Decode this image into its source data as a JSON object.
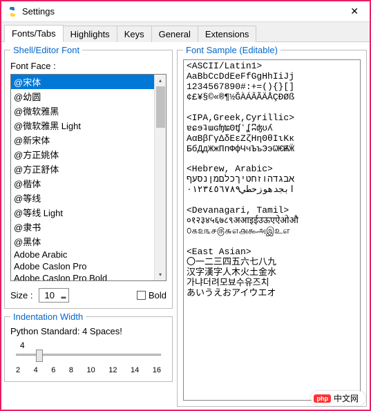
{
  "window": {
    "title": "Settings"
  },
  "tabs": [
    {
      "label": "Fonts/Tabs",
      "active": true
    },
    {
      "label": "Highlights"
    },
    {
      "label": "Keys"
    },
    {
      "label": "General"
    },
    {
      "label": "Extensions"
    }
  ],
  "shell_font": {
    "legend": "Shell/Editor Font",
    "face_label": "Font Face :",
    "items": [
      "@宋体",
      "@幼圆",
      "@微软雅黑",
      "@微软雅黑 Light",
      "@新宋体",
      "@方正姚体",
      "@方正舒体",
      "@楷体",
      "@等线",
      "@等线 Light",
      "@隶书",
      "@黑体",
      "Adobe Arabic",
      "Adobe Caslon Pro",
      "Adobe Caslon Pro Bold"
    ],
    "selected_index": 0,
    "size_label": "Size :",
    "size_value": "10",
    "bold_label": "Bold",
    "bold_checked": false
  },
  "indent": {
    "legend": "Indentation Width",
    "label": "Python Standard: 4 Spaces!",
    "value": "4",
    "ticks": [
      "2",
      "4",
      "6",
      "8",
      "10",
      "12",
      "14",
      "16"
    ]
  },
  "sample": {
    "legend": "Font Sample (Editable)",
    "lines": [
      "<ASCII/Latin1>",
      "AaBbCcDdEeFfGgHhIiJj",
      "1234567890#:+=(){}[]",
      "¢£¥§©«®¶½ĞÀÁÂÃÄÅÇÐØß",
      "",
      "<IPA,Greek,Cyrillic>",
      "ɐɕɘʇɯɢʩʨʘʧʻʆʭʤʊʎ",
      "ΑαΒβΓγΔδΕεΖζΗηΘθΙιΚκ",
      "БбДдЖжПпФфЧчЪъЭэѠѤѬӜ",
      "",
      "<Hebrew, Arabic>",
      "אבגדהוזחטיךכלםמןנסעף",
      "ابجدهوزحطي٠١٢٣٤٥٦٧٨٩",
      "",
      "<Devanagari, Tamil>",
      "०१२३४५६७८९अआइईउऊएऐओऔ",
      "௦௧௨௩௪௫௬௭௮௯அஇஉஎ",
      "",
      "<East Asian>",
      "〇一二三四五六七八九",
      "汉字漢字人木火土金水",
      "가냐더려모뵤수유즈치",
      "あいうえおアイウエオ"
    ]
  },
  "watermark": {
    "badge": "php",
    "text": "中文网"
  }
}
